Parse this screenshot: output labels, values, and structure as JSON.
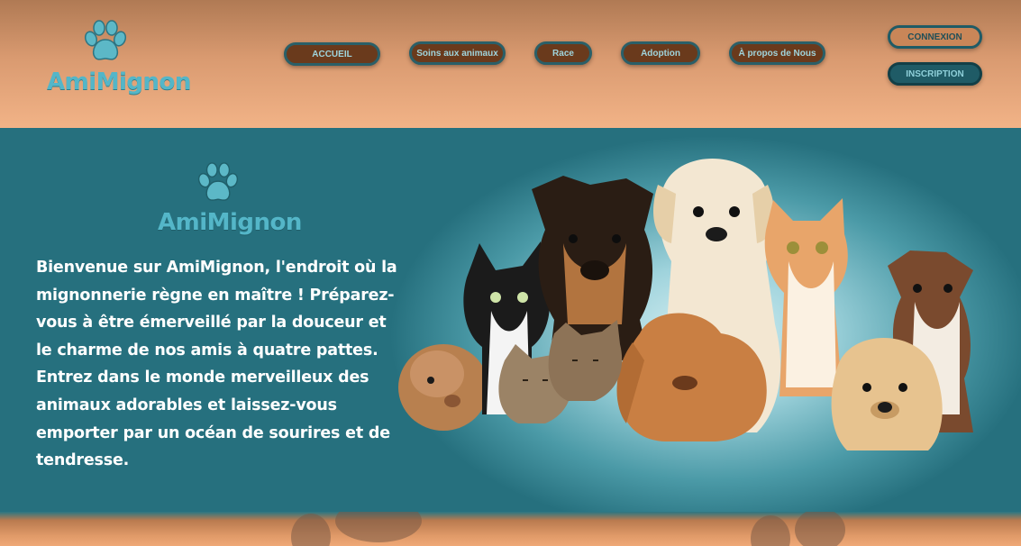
{
  "brand": {
    "name": "AmiMignon"
  },
  "nav": {
    "items": [
      {
        "label": "ACCUEIL"
      },
      {
        "label": "Soins aux animaux"
      },
      {
        "label": "Race"
      },
      {
        "label": "Adoption"
      },
      {
        "label": "À propos de Nous"
      }
    ]
  },
  "auth": {
    "login_label": "CONNEXION",
    "signup_label": "INSCRIPTION"
  },
  "hero": {
    "brand": "AmiMignon",
    "welcome_text": "Bienvenue sur AmiMignon, l'endroit où la mignonnerie règne en maître ! Préparez-vous à être émerveillé par la douceur et le charme de nos amis à quatre pattes. Entrez dans le monde merveilleux des animaux adorables et laissez-vous emporter par un océan de sourires et de tendresse."
  },
  "colors": {
    "header_top": "#b07a54",
    "header_bottom": "#f2b387",
    "hero_teal": "#2b7683",
    "nav_button": "#6a3a1c",
    "accent": "#54b6c8"
  },
  "icons": {
    "logo": "paw-icon"
  }
}
